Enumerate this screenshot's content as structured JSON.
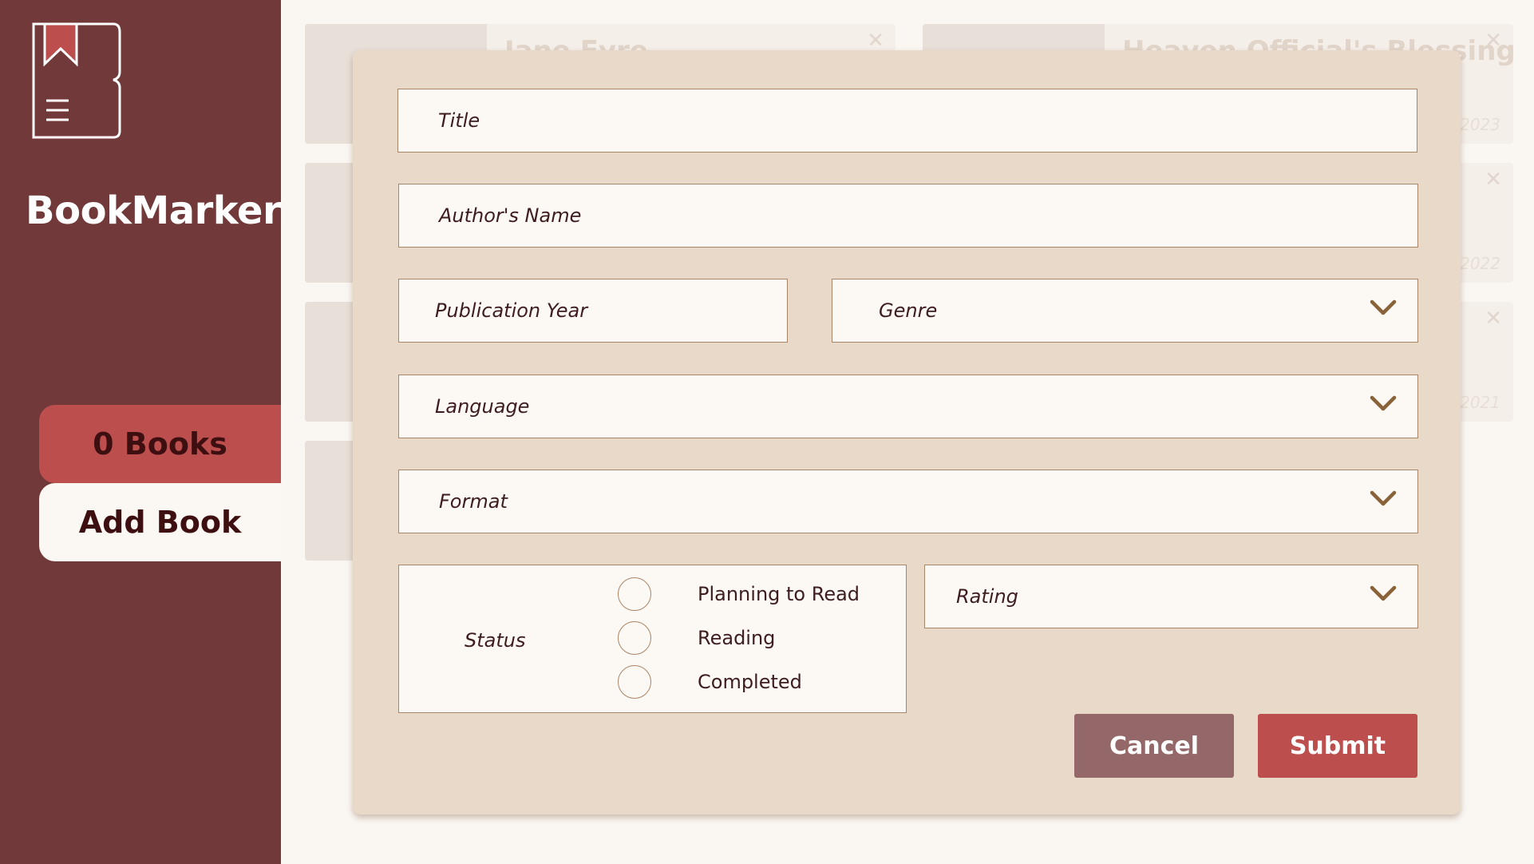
{
  "sidebar": {
    "brand": "BookMarker",
    "book_count_label": "0 Books",
    "add_book_label": "Add Book"
  },
  "background_cards": [
    {
      "title": "Jane Eyre",
      "date": ""
    },
    {
      "title": "Heaven Official's Blessing",
      "date": "/2023"
    },
    {
      "title": "...",
      "date": "/2022"
    },
    {
      "title": "...",
      "date": "/2021"
    }
  ],
  "form": {
    "title_placeholder": "Title",
    "author_placeholder": "Author's Name",
    "year_placeholder": "Publication Year",
    "genre_placeholder": "Genre",
    "language_placeholder": "Language",
    "format_placeholder": "Format",
    "status_label": "Status",
    "status_options": [
      "Planning to Read",
      "Reading",
      "Completed"
    ],
    "rating_placeholder": "Rating",
    "cancel_label": "Cancel",
    "submit_label": "Submit"
  },
  "colors": {
    "sidebar": "#713939",
    "accent": "#bc4e4e",
    "modal": "#e9d9c8",
    "cancel": "#946769"
  },
  "icons": {
    "logo": "bookmark-logo-icon",
    "dropdown": "chevron-down-icon",
    "close": "close-icon"
  }
}
